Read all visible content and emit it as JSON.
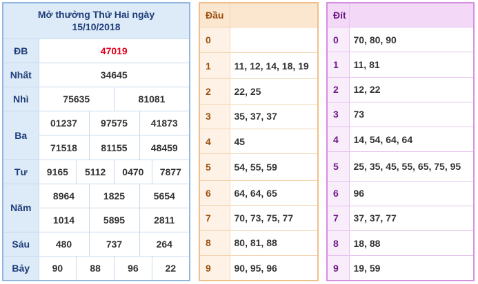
{
  "results": {
    "title_line1": "Mở thưởng Thứ Hai ngày",
    "title_line2": "15/10/2018",
    "rows": {
      "db": {
        "label": "ĐB",
        "values": [
          "47019"
        ]
      },
      "nhat": {
        "label": "Nhất",
        "values": [
          "34645"
        ]
      },
      "nhi": {
        "label": "Nhì",
        "values": [
          "75635",
          "81081"
        ]
      },
      "ba": {
        "label": "Ba",
        "values": [
          "01237",
          "97575",
          "41873",
          "71518",
          "81155",
          "48459"
        ]
      },
      "tu": {
        "label": "Tư",
        "values": [
          "9165",
          "5112",
          "0470",
          "7877"
        ]
      },
      "nam": {
        "label": "Năm",
        "values": [
          "8964",
          "1825",
          "5654",
          "1014",
          "5895",
          "2811"
        ]
      },
      "sau": {
        "label": "Sáu",
        "values": [
          "480",
          "737",
          "264"
        ]
      },
      "bay": {
        "label": "Bảy",
        "values": [
          "90",
          "88",
          "96",
          "22"
        ]
      }
    },
    "colors": {
      "border": "#8fb7e0",
      "label_bg": "#ddeaf7",
      "label_text": "#1f3d7a",
      "special_prize": "#e0001b"
    }
  },
  "dau": {
    "header": "Đầu",
    "rows": [
      {
        "key": "0",
        "value": ""
      },
      {
        "key": "1",
        "value": "11, 12, 14, 18, 19"
      },
      {
        "key": "2",
        "value": "22, 25"
      },
      {
        "key": "3",
        "value": "35, 37, 37"
      },
      {
        "key": "4",
        "value": "45"
      },
      {
        "key": "5",
        "value": "54, 55, 59"
      },
      {
        "key": "6",
        "value": "64, 64, 65"
      },
      {
        "key": "7",
        "value": "70, 73, 75, 77"
      },
      {
        "key": "8",
        "value": "80, 81, 88"
      },
      {
        "key": "9",
        "value": "90, 95, 96"
      }
    ],
    "colors": {
      "border": "#f0be8a",
      "key_text": "#9a4f0f"
    }
  },
  "dit": {
    "header": "Đít",
    "rows": [
      {
        "key": "0",
        "value": "70, 80, 90"
      },
      {
        "key": "1",
        "value": "11, 81"
      },
      {
        "key": "2",
        "value": "12, 22"
      },
      {
        "key": "3",
        "value": "73"
      },
      {
        "key": "4",
        "value": "14, 54, 64, 64"
      },
      {
        "key": "5",
        "value": "25, 35, 45, 55, 65, 75, 95"
      },
      {
        "key": "6",
        "value": "96"
      },
      {
        "key": "7",
        "value": "37, 37, 77"
      },
      {
        "key": "8",
        "value": "18, 88"
      },
      {
        "key": "9",
        "value": "19, 59"
      }
    ],
    "colors": {
      "border": "#d58ee0",
      "key_text": "#6b1b86"
    }
  }
}
